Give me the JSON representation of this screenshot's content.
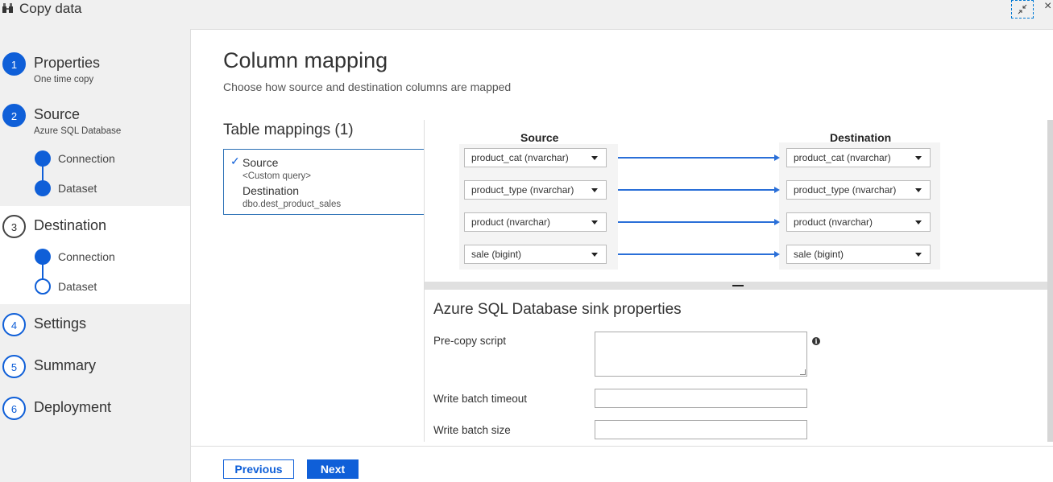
{
  "window": {
    "title": "Copy data",
    "icon": "copy-data-icon",
    "restore_icon": "collapse-arrows-icon",
    "close_glyph": "×"
  },
  "sidebar": {
    "steps": [
      {
        "number": "1",
        "label": "Properties",
        "sub": "One time copy",
        "state": "complete"
      },
      {
        "number": "2",
        "label": "Source",
        "sub": "Azure SQL Database",
        "state": "complete",
        "substeps": [
          {
            "label": "Connection",
            "state": "complete"
          },
          {
            "label": "Dataset",
            "state": "complete"
          }
        ]
      },
      {
        "number": "3",
        "label": "Destination",
        "state": "current",
        "substeps": [
          {
            "label": "Connection",
            "state": "complete"
          },
          {
            "label": "Dataset",
            "state": "current"
          }
        ]
      },
      {
        "number": "4",
        "label": "Settings",
        "state": "pending"
      },
      {
        "number": "5",
        "label": "Summary",
        "state": "pending"
      },
      {
        "number": "6",
        "label": "Deployment",
        "state": "pending"
      }
    ]
  },
  "main": {
    "title": "Column mapping",
    "subtitle": "Choose how source and destination columns are mapped",
    "table_mappings": {
      "title": "Table mappings (1)",
      "items": [
        {
          "checked": true,
          "source_label": "Source",
          "source_value": "<Custom query>",
          "destination_label": "Destination",
          "destination_value": "dbo.dest_product_sales"
        }
      ]
    },
    "column_mapping": {
      "source_header": "Source",
      "destination_header": "Destination",
      "rows": [
        {
          "source": "product_cat (nvarchar)",
          "destination": "product_cat (nvarchar)"
        },
        {
          "source": "product_type (nvarchar)",
          "destination": "product_type (nvarchar)"
        },
        {
          "source": "product (nvarchar)",
          "destination": "product (nvarchar)"
        },
        {
          "source": "sale (bigint)",
          "destination": "sale (bigint)"
        }
      ]
    },
    "sink": {
      "title": "Azure SQL Database sink properties",
      "pre_copy_label": "Pre-copy script",
      "pre_copy_value": "",
      "timeout_label": "Write batch timeout",
      "timeout_value": "",
      "batch_size_label": "Write batch size",
      "batch_size_value": ""
    }
  },
  "footer": {
    "previous_label": "Previous",
    "next_label": "Next"
  },
  "colors": {
    "accent": "#0f5fd8",
    "arrow": "#2a6fd8"
  }
}
